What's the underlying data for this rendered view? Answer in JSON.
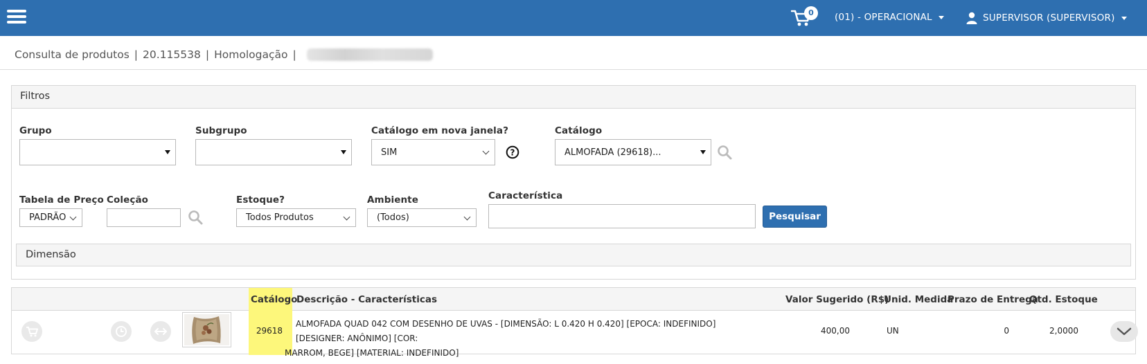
{
  "topbar": {
    "cart_count": "0",
    "unit_menu": "(01) - OPERACIONAL",
    "user_menu": "SUPERVISOR (SUPERVISOR)"
  },
  "breadcrumb": {
    "page": "Consulta de produtos",
    "version": "20.115538",
    "environment": "Homologação"
  },
  "filters": {
    "title": "Filtros",
    "grupo_label": "Grupo",
    "grupo_value": "",
    "subgrupo_label": "Subgrupo",
    "subgrupo_value": "",
    "nova_janela_label": "Catálogo em nova janela?",
    "nova_janela_value": "SIM",
    "catalogo_label": "Catálogo",
    "catalogo_value": "ALMOFADA (29618)...",
    "tabela_label": "Tabela de Preço",
    "tabela_value": "PADRÃO",
    "colecao_label": "Coleção",
    "colecao_value": "",
    "estoque_label": "Estoque?",
    "estoque_value": "Todos Produtos",
    "ambiente_label": "Ambiente",
    "ambiente_value": "(Todos)",
    "caracteristica_label": "Característica",
    "caracteristica_value": "",
    "search_button": "Pesquisar",
    "dimensao_label": "Dimensão"
  },
  "table": {
    "headers": {
      "catalogo": "Catálogo",
      "descricao": "Descrição - Características",
      "valor": "Valor Sugerido (R$)",
      "unid": "Unid. Medida",
      "prazo": "Prazo de Entrega",
      "qtd": "Qtd. Estoque"
    },
    "rows": [
      {
        "catalogo": "29618",
        "descricao_line1": "ALMOFADA QUAD 042 COM DESENHO DE UVAS - [DIMENSÃO: L 0.420 H 0.420] [EPOCA: INDEFINIDO] [DESIGNER: ANÔNIMO] [COR:",
        "descricao_line2": "MARROM, BEGE] [MATERIAL: INDEFINIDO]",
        "valor": "400,00",
        "unid": "UN",
        "prazo": "0",
        "qtd": "2,0000"
      }
    ]
  },
  "colors": {
    "topbar": "#2e6fb0",
    "highlight": "#fdf77b",
    "panel_header": "#f5f5f5"
  }
}
